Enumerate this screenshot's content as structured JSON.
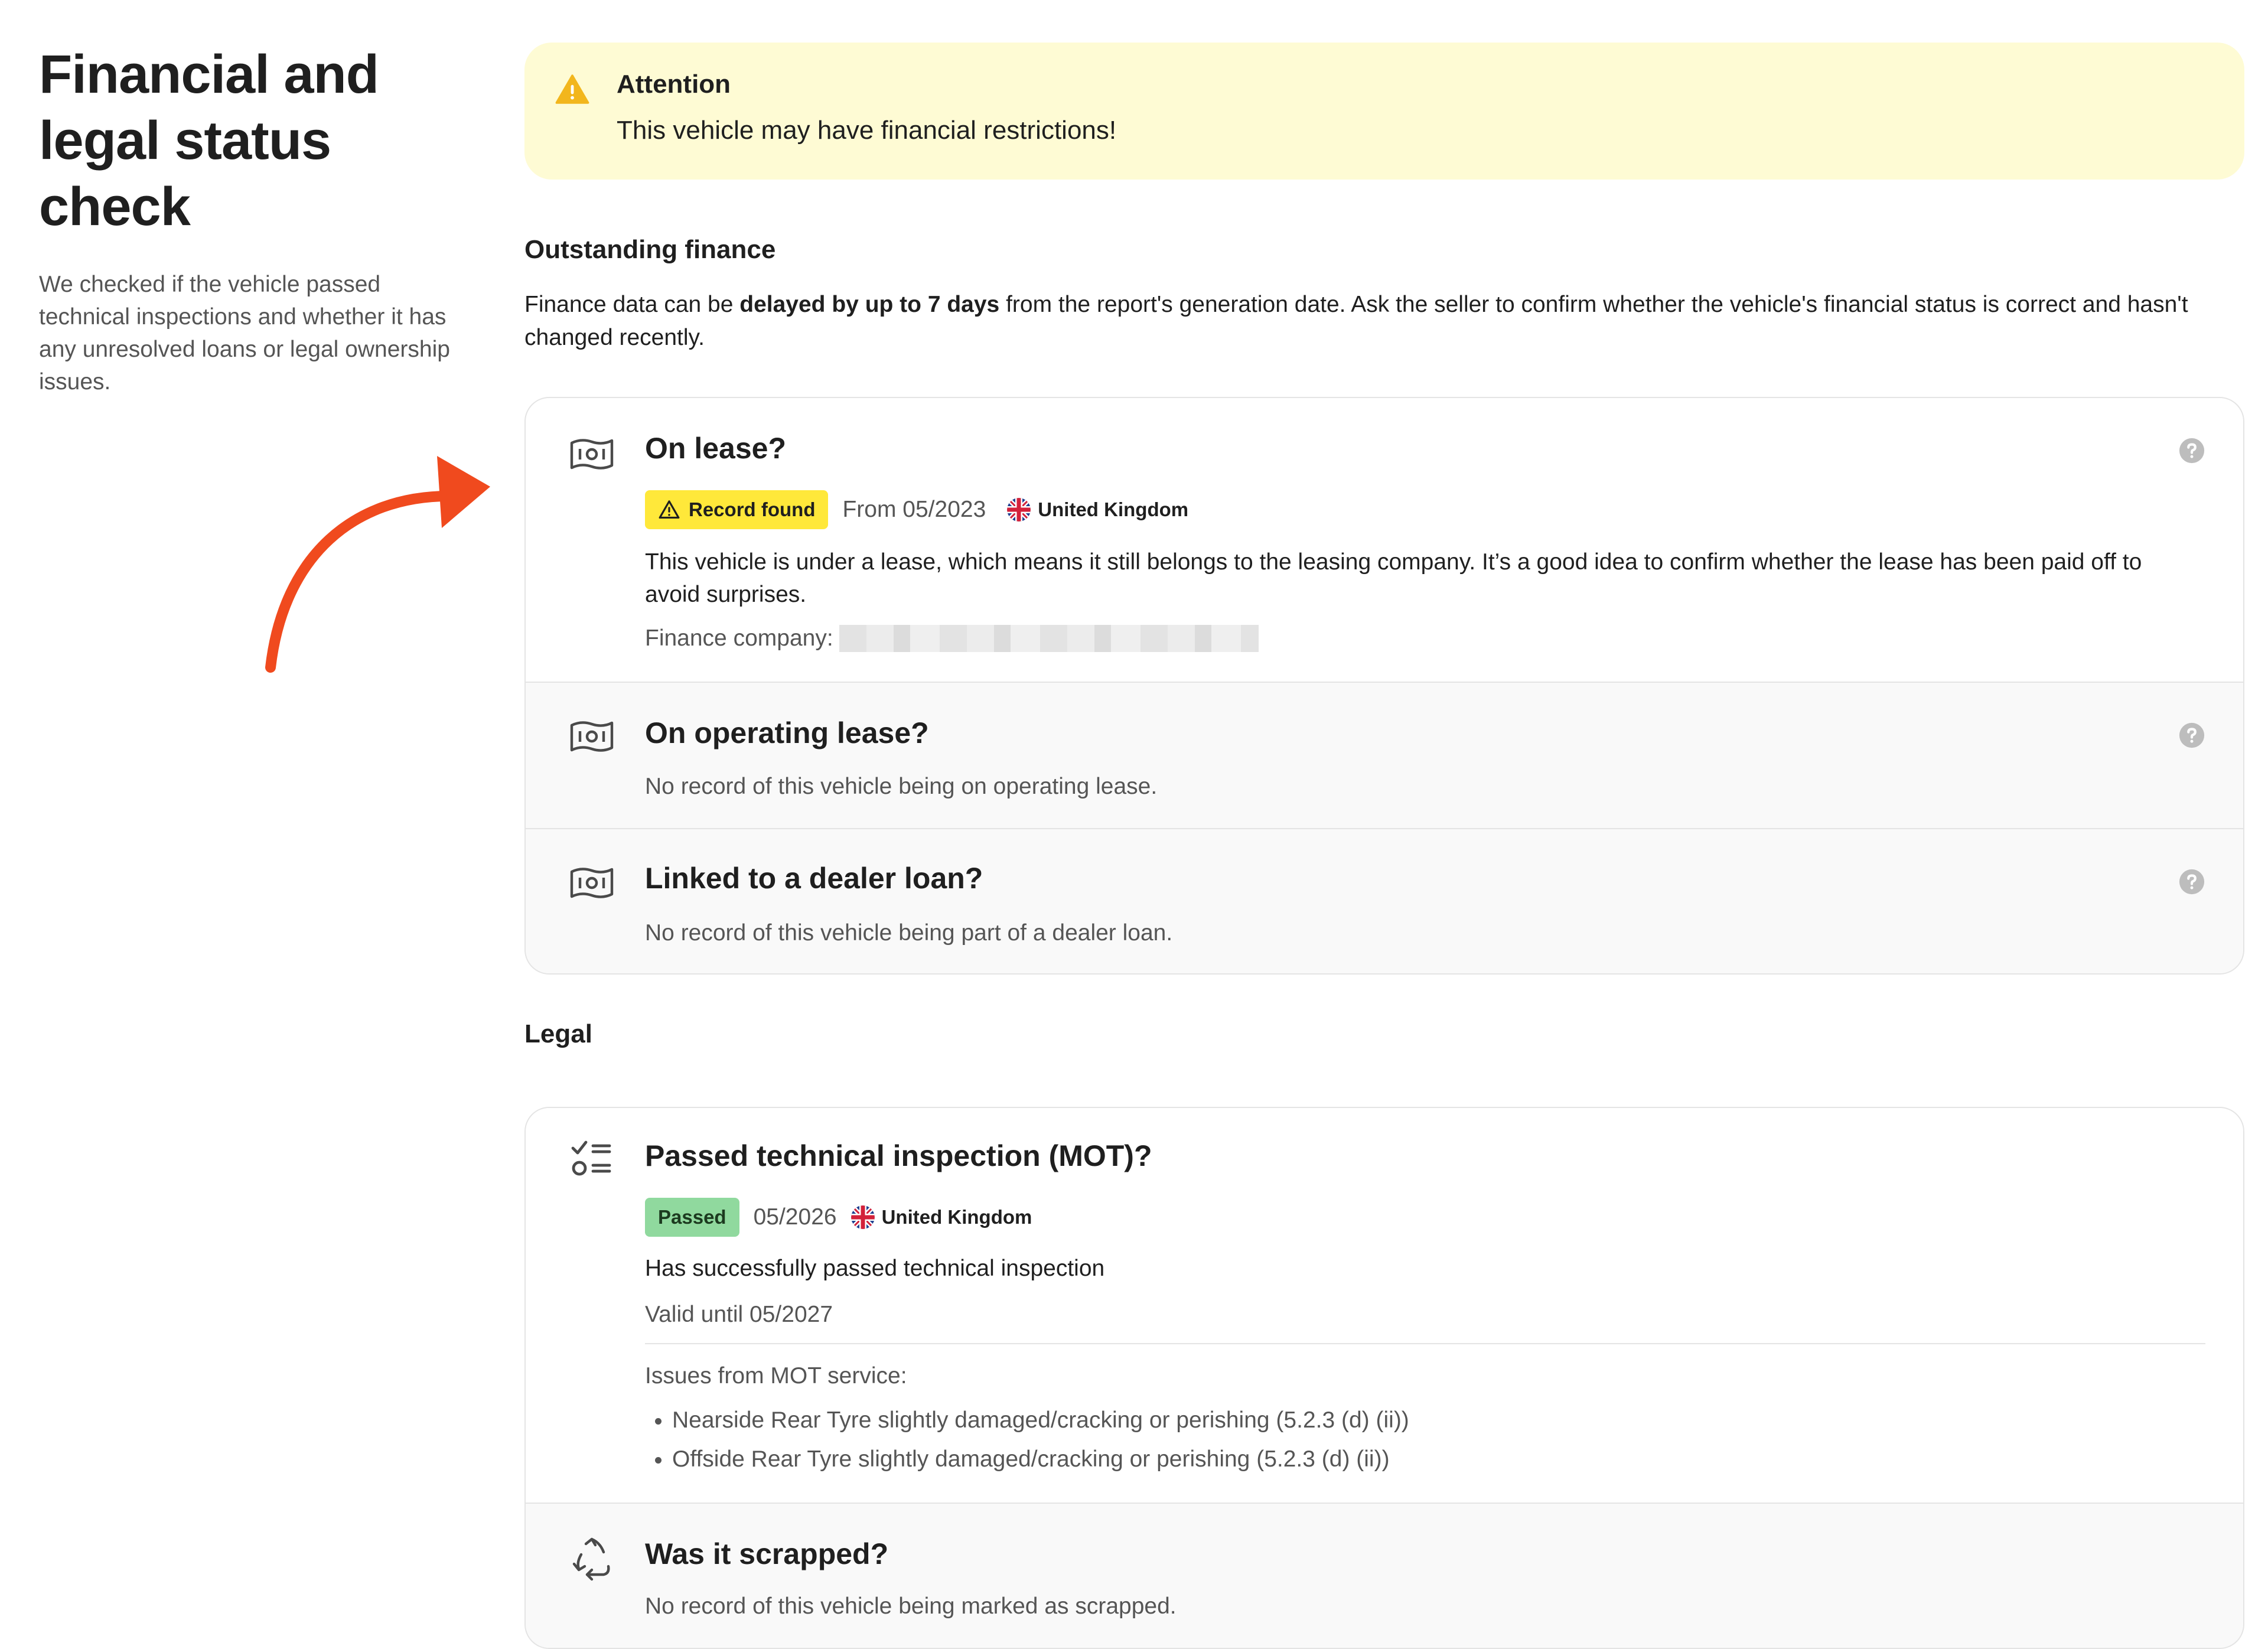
{
  "page": {
    "title": "Financial and legal status check",
    "description": "We checked if the vehicle passed technical inspections and whether it has any unresolved loans or legal ownership issues."
  },
  "alert": {
    "title": "Attention",
    "text": "This vehicle may have financial restrictions!"
  },
  "finance": {
    "heading": "Outstanding finance",
    "note_pre": "Finance data can be ",
    "note_bold": "delayed by up to 7 days",
    "note_post": " from the report's generation date. Ask the seller to confirm whether the vehicle's financial status is correct and hasn't changed recently.",
    "items": [
      {
        "title": "On lease?",
        "badge": "Record found",
        "date": "From 05/2023",
        "country": "United Kingdom",
        "description": "This vehicle is under a lease, which means it still belongs to the leasing company. It’s a good idea to confirm whether the lease has been paid off to avoid surprises.",
        "company_label": "Finance company:"
      },
      {
        "title": "On operating lease?",
        "description": "No record of this vehicle being on operating lease."
      },
      {
        "title": "Linked to a dealer loan?",
        "description": "No record of this vehicle being part of a dealer loan."
      }
    ]
  },
  "legal": {
    "heading": "Legal",
    "items": [
      {
        "title": "Passed technical inspection (MOT)?",
        "badge": "Passed",
        "date": "05/2026",
        "country": "United Kingdom",
        "description": "Has successfully passed technical inspection",
        "valid": "Valid until 05/2027",
        "issues_label": "Issues from MOT service:",
        "issues": [
          "Nearside Rear Tyre slightly damaged/cracking or perishing (5.2.3 (d) (ii))",
          "Offside Rear Tyre slightly damaged/cracking or perishing (5.2.3 (d) (ii))"
        ]
      },
      {
        "title": "Was it scrapped?",
        "description": "No record of this vehicle being marked as scrapped."
      }
    ]
  },
  "colors": {
    "alert_bg": "#fefbd4",
    "warn_badge": "#ffe83a",
    "pass_badge": "#90d99e",
    "arrow": "#f04a1e"
  },
  "icons": [
    "warning-icon",
    "banknote-icon",
    "help-icon",
    "uk-flag-icon",
    "checklist-icon",
    "recycle-icon",
    "arrow-icon"
  ]
}
